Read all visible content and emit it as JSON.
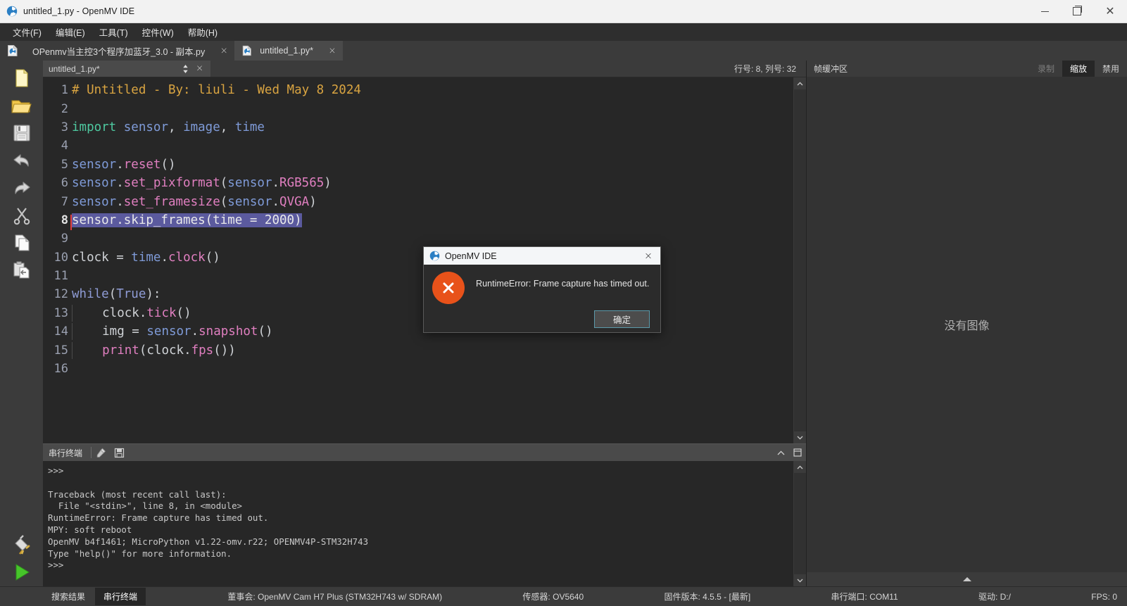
{
  "window": {
    "title": "untitled_1.py - OpenMV IDE",
    "app_icon": "openmv-logo-icon",
    "minimize": "minimize-icon",
    "maximize": "maximize-icon",
    "close": "close-icon"
  },
  "menubar": {
    "items": [
      {
        "label": "文件(F)",
        "accel": "F"
      },
      {
        "label": "编辑(E)",
        "accel": "E"
      },
      {
        "label": "工具(T)",
        "accel": "T"
      },
      {
        "label": "控件(W)",
        "accel": "W"
      },
      {
        "label": "帮助(H)",
        "accel": "H"
      }
    ]
  },
  "tabs": [
    {
      "label": "OPenmv当主控3个程序加蓝牙_3.0 - 副本.py",
      "active": false,
      "close": "×"
    },
    {
      "label": "untitled_1.py*",
      "active": true,
      "close": "×"
    }
  ],
  "left_toolbar": {
    "items": [
      {
        "name": "new-file-icon",
        "tip": "新建"
      },
      {
        "name": "open-file-icon",
        "tip": "打开"
      },
      {
        "name": "save-file-icon",
        "tip": "保存"
      },
      {
        "name": "undo-icon",
        "tip": "撤销"
      },
      {
        "name": "redo-icon",
        "tip": "重做"
      },
      {
        "name": "cut-icon",
        "tip": "剪切"
      },
      {
        "name": "copy-icon",
        "tip": "复制"
      },
      {
        "name": "paste-icon",
        "tip": "粘贴"
      }
    ],
    "connect": {
      "name": "connect-plug-icon"
    },
    "run": {
      "name": "run-play-icon"
    }
  },
  "editor": {
    "filename": "untitled_1.py*",
    "sort_icon": "sort-updown-icon",
    "close_icon": "×",
    "line_info": "行号: 8, 列号: 32",
    "cursor_line": 8,
    "lines": [
      {
        "n": 1,
        "tokens": [
          {
            "t": "# Untitled - By: liuli - Wed May 8 2024",
            "c": "tk-comment"
          }
        ]
      },
      {
        "n": 2,
        "tokens": []
      },
      {
        "n": 3,
        "tokens": [
          {
            "t": "import",
            "c": "tk-kw"
          },
          {
            "t": " ",
            "c": "tk-plain"
          },
          {
            "t": "sensor",
            "c": "tk-mod"
          },
          {
            "t": ", ",
            "c": "tk-punct"
          },
          {
            "t": "image",
            "c": "tk-mod"
          },
          {
            "t": ", ",
            "c": "tk-punct"
          },
          {
            "t": "time",
            "c": "tk-mod"
          }
        ]
      },
      {
        "n": 4,
        "tokens": []
      },
      {
        "n": 5,
        "tokens": [
          {
            "t": "sensor",
            "c": "tk-mod"
          },
          {
            "t": ".",
            "c": "tk-punct"
          },
          {
            "t": "reset",
            "c": "tk-fn"
          },
          {
            "t": "()",
            "c": "tk-plain"
          }
        ]
      },
      {
        "n": 6,
        "tokens": [
          {
            "t": "sensor",
            "c": "tk-mod"
          },
          {
            "t": ".",
            "c": "tk-punct"
          },
          {
            "t": "set_pixformat",
            "c": "tk-fn"
          },
          {
            "t": "(",
            "c": "tk-plain"
          },
          {
            "t": "sensor",
            "c": "tk-mod"
          },
          {
            "t": ".",
            "c": "tk-punct"
          },
          {
            "t": "RGB565",
            "c": "tk-fn"
          },
          {
            "t": ")",
            "c": "tk-plain"
          }
        ]
      },
      {
        "n": 7,
        "tokens": [
          {
            "t": "sensor",
            "c": "tk-mod"
          },
          {
            "t": ".",
            "c": "tk-punct"
          },
          {
            "t": "set_framesize",
            "c": "tk-fn"
          },
          {
            "t": "(",
            "c": "tk-plain"
          },
          {
            "t": "sensor",
            "c": "tk-mod"
          },
          {
            "t": ".",
            "c": "tk-punct"
          },
          {
            "t": "QVGA",
            "c": "tk-fn"
          },
          {
            "t": ")",
            "c": "tk-plain"
          }
        ]
      },
      {
        "n": 8,
        "selected": true,
        "tokens": [
          {
            "t": "sensor.skip_frames(time = 2000)",
            "c": "sel"
          }
        ]
      },
      {
        "n": 9,
        "tokens": []
      },
      {
        "n": 10,
        "tokens": [
          {
            "t": "clock ",
            "c": "tk-plain"
          },
          {
            "t": "= ",
            "c": "tk-punct"
          },
          {
            "t": "time",
            "c": "tk-mod"
          },
          {
            "t": ".",
            "c": "tk-punct"
          },
          {
            "t": "clock",
            "c": "tk-fn"
          },
          {
            "t": "()",
            "c": "tk-plain"
          }
        ]
      },
      {
        "n": 11,
        "tokens": []
      },
      {
        "n": 12,
        "tokens": [
          {
            "t": "while",
            "c": "tk-kw2"
          },
          {
            "t": "(",
            "c": "tk-plain"
          },
          {
            "t": "True",
            "c": "tk-kw2"
          },
          {
            "t": "):",
            "c": "tk-plain"
          }
        ]
      },
      {
        "n": 13,
        "indent": 1,
        "tokens": [
          {
            "t": "    clock",
            "c": "tk-plain"
          },
          {
            "t": ".",
            "c": "tk-punct"
          },
          {
            "t": "tick",
            "c": "tk-fn"
          },
          {
            "t": "()",
            "c": "tk-plain"
          }
        ]
      },
      {
        "n": 14,
        "indent": 1,
        "tokens": [
          {
            "t": "    img ",
            "c": "tk-plain"
          },
          {
            "t": "= ",
            "c": "tk-punct"
          },
          {
            "t": "sensor",
            "c": "tk-mod"
          },
          {
            "t": ".",
            "c": "tk-punct"
          },
          {
            "t": "snapshot",
            "c": "tk-fn"
          },
          {
            "t": "()",
            "c": "tk-plain"
          }
        ]
      },
      {
        "n": 15,
        "indent": 1,
        "tokens": [
          {
            "t": "    ",
            "c": "tk-plain"
          },
          {
            "t": "print",
            "c": "tk-fn"
          },
          {
            "t": "(clock",
            "c": "tk-plain"
          },
          {
            "t": ".",
            "c": "tk-punct"
          },
          {
            "t": "fps",
            "c": "tk-fn"
          },
          {
            "t": "())",
            "c": "tk-plain"
          }
        ]
      },
      {
        "n": 16,
        "tokens": []
      }
    ]
  },
  "terminal": {
    "title": "串行终端",
    "icons": [
      {
        "name": "clear-terminal-icon"
      },
      {
        "name": "save-terminal-icon"
      }
    ],
    "collapse_icon": "⌃",
    "detach_icon": "⊡",
    "text": ">>>\n\nTraceback (most recent call last):\n  File \"<stdin>\", line 8, in <module>\nRuntimeError: Frame capture has timed out.\nMPY: soft reboot\nOpenMV b4f1461; MicroPython v1.22-omv.r22; OPENMV4P-STM32H743\nType \"help()\" for more information.\n>>>"
  },
  "framebuffer": {
    "title": "帧缓冲区",
    "buttons": [
      {
        "label": "录制",
        "state": "disabled"
      },
      {
        "label": "缩放",
        "state": "active"
      },
      {
        "label": "禁用",
        "state": "normal"
      }
    ],
    "no_image_text": "没有图像",
    "footer_icon": "chevron-up-icon"
  },
  "statusbar": {
    "tabs": [
      {
        "label": "搜索结果",
        "active": false
      },
      {
        "label": "串行终端",
        "active": true
      }
    ],
    "fields": [
      {
        "label": "董事会:",
        "value": "OpenMV Cam H7 Plus (STM32H743 w/ SDRAM)"
      },
      {
        "label": "传感器:",
        "value": "OV5640"
      },
      {
        "label": "固件版本:",
        "value": "4.5.5 - [最新]"
      },
      {
        "label": "串行端口:",
        "value": "COM11"
      },
      {
        "label": "驱动:",
        "value": "D:/"
      },
      {
        "label": "FPS:",
        "value": "0"
      }
    ]
  },
  "dialog": {
    "title": "OpenMV IDE",
    "icon": "openmv-logo-icon",
    "close": "×",
    "error_icon": "error-cross-icon",
    "message": "RuntimeError: Frame capture has timed out.",
    "ok_label": "确定"
  },
  "colors": {
    "accent_orange": "#e8521a",
    "selection": "#5b5a9e",
    "comment": "#d9a441",
    "function": "#e07fc0",
    "module": "#7f9bd8",
    "keyword": "#4ec9a0",
    "run_green": "#46c52a"
  }
}
